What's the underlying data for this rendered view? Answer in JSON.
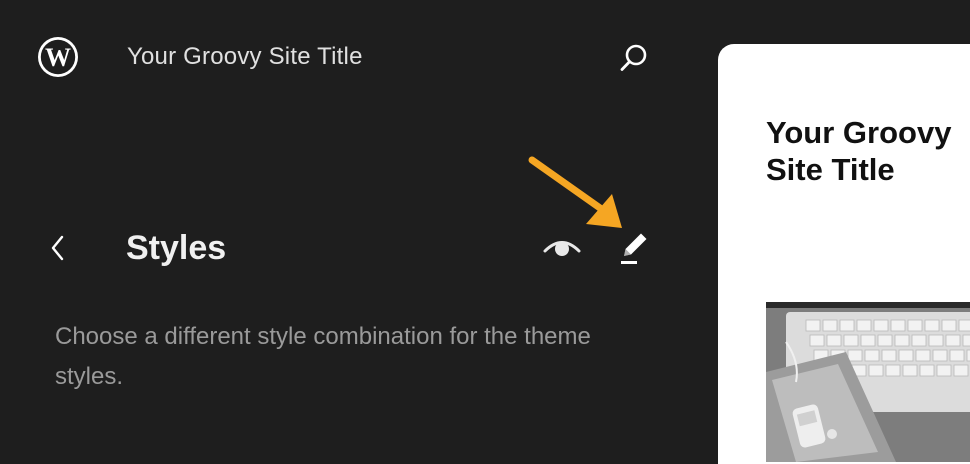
{
  "header": {
    "logo_icon": "wordpress-logo-icon",
    "site_title": "Your Groovy Site Title",
    "search_icon": "search-icon"
  },
  "panel": {
    "back_icon": "chevron-left-icon",
    "title": "Styles",
    "preview_icon": "eye-icon",
    "edit_icon": "pencil-icon",
    "description": "Choose a different style combination for the theme styles."
  },
  "annotation": {
    "arrow_color": "#f5a623"
  },
  "preview": {
    "site_title": "Your Groovy Site Title",
    "image_icon": "laptop-photo"
  },
  "colors": {
    "sidebar_bg": "#1e1e1e",
    "text_primary": "#f0f0f0",
    "text_secondary": "#9a9a9a",
    "preview_bg": "#ffffff"
  }
}
